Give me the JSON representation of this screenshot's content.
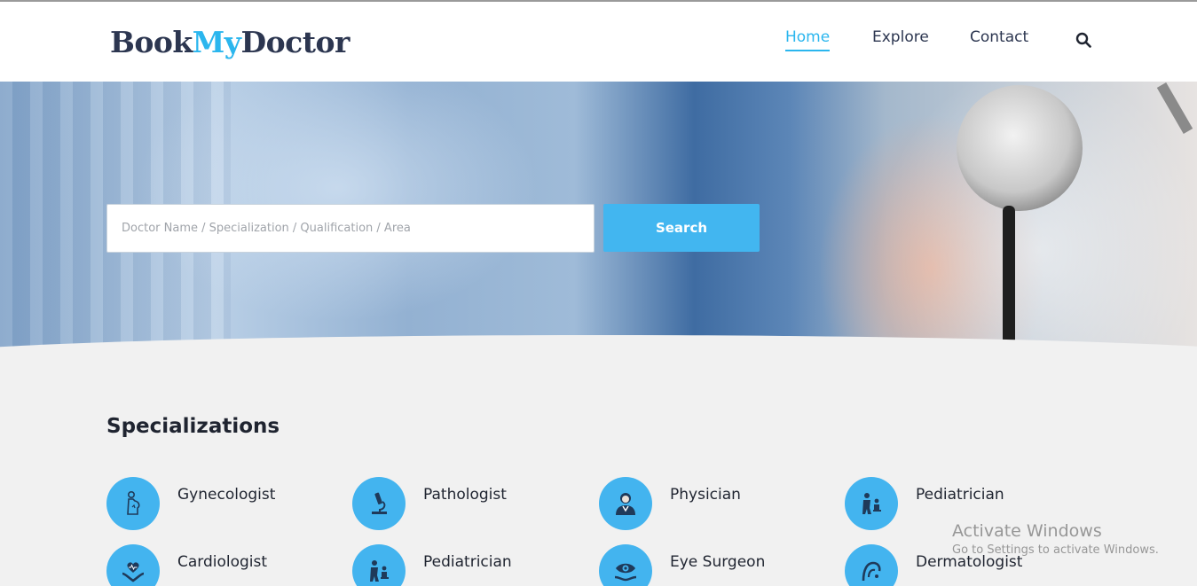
{
  "logo": {
    "part1": "Book",
    "part2": "My",
    "part3": "Doctor"
  },
  "nav": [
    {
      "label": "Home",
      "active": true
    },
    {
      "label": "Explore",
      "active": false
    },
    {
      "label": "Contact",
      "active": false
    }
  ],
  "nav_search_icon": "search-icon",
  "search": {
    "placeholder": "Doctor Name / Specialization / Qualification / Area",
    "value": "",
    "button_label": "Search"
  },
  "specializations": {
    "title": "Specializations",
    "items": [
      {
        "label": "Gynecologist",
        "icon": "pregnant-woman-icon"
      },
      {
        "label": "Pathologist",
        "icon": "microscope-icon"
      },
      {
        "label": "Physician",
        "icon": "doctor-icon"
      },
      {
        "label": "Pediatrician",
        "icon": "child-care-icon"
      },
      {
        "label": "Cardiologist",
        "icon": "heart-hand-icon"
      },
      {
        "label": "Pediatrician",
        "icon": "child-care-icon"
      },
      {
        "label": "Eye Surgeon",
        "icon": "eye-hand-icon"
      },
      {
        "label": "Dermatologist",
        "icon": "skin-care-icon"
      }
    ]
  },
  "watermark": {
    "title": "Activate Windows",
    "subtitle": "Go to Settings to activate Windows."
  },
  "colors": {
    "brand_dark": "#2c3650",
    "accent": "#2bb6ee",
    "button": "#42b6f0",
    "page_bg": "#f1f1f1"
  }
}
